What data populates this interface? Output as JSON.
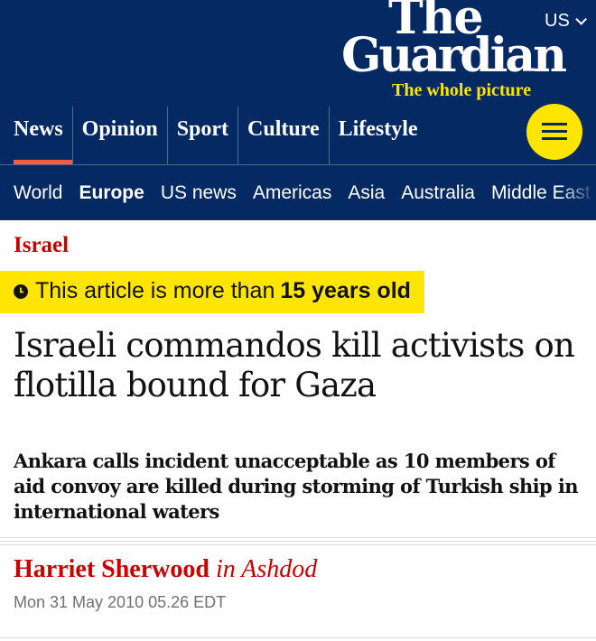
{
  "header": {
    "edition": "US",
    "logo": {
      "line1": "The",
      "line2": "Guardian",
      "tagline": "The whole picture"
    },
    "pillars": [
      "News",
      "Opinion",
      "Sport",
      "Culture",
      "Lifestyle"
    ],
    "active_pillar": "News",
    "subnav": [
      "World",
      "Europe",
      "US news",
      "Americas",
      "Asia",
      "Australia",
      "Middle East"
    ],
    "active_subnav": "Europe",
    "colors": {
      "brand": "#052962",
      "accent": "#ffe500",
      "news_red": "#c70000",
      "pillar_underline": "#ff5943"
    }
  },
  "article": {
    "section": "Israel",
    "age_warning": {
      "prefix": "This article is more than",
      "emphasis": "15 years old",
      "icon": "clock-icon"
    },
    "headline": "Israeli commandos kill activists on flotilla bound for Gaza",
    "standfirst": "Ankara calls incident unacceptable as 10 members of aid convoy are killed during storming of Turkish ship in international waters",
    "author": "Harriet Sherwood",
    "location": "in Ashdod",
    "date": "Mon 31 May 2010 05.26 EDT"
  }
}
